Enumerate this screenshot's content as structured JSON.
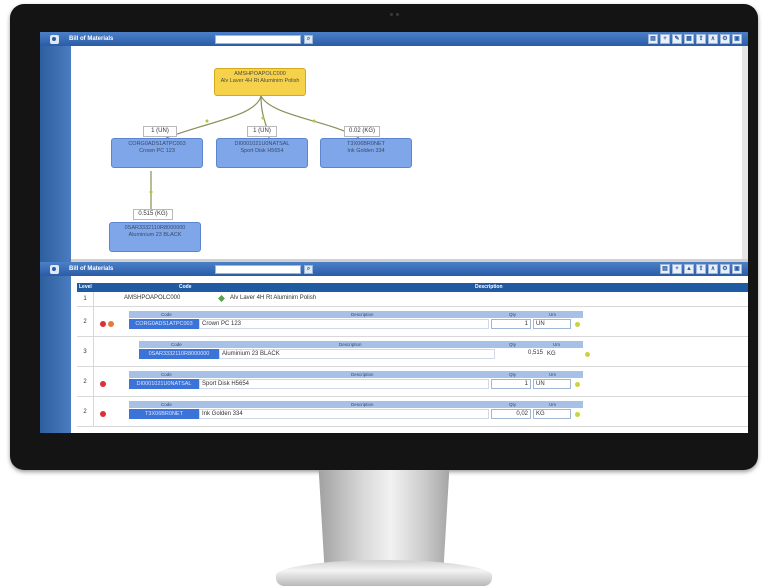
{
  "top_panel": {
    "title": "Bill of Materials",
    "tree": {
      "root": {
        "code": "AMSHPOAPOLC000",
        "desc": "Alv Laver 4H Rt Aluminim Polish"
      },
      "children": [
        {
          "qty": "1 (UN)",
          "code": "CORG0ADS1ATPC003",
          "desc": "Crown PC 123"
        },
        {
          "qty": "1 (UN)",
          "code": "DI0001021U0NATSAL",
          "desc": "Sport Disk H5654"
        },
        {
          "qty": "0.02 (KG)",
          "code": "T3X06BR0NET",
          "desc": "Ink Golden 334"
        }
      ],
      "grandchild": {
        "qty": "0.515 (KG)",
        "code": "0SAR3332110R8000000",
        "desc": "Aluminium 23 BLACK"
      }
    }
  },
  "bottom_panel": {
    "title": "Bill of Materials",
    "headers": {
      "level": "Level",
      "code": "Code",
      "description": "Description"
    },
    "sub_headers": {
      "code": "Code",
      "description": "Description",
      "qty": "Qty",
      "um": "Um"
    },
    "rows": [
      {
        "level": "1",
        "code": "AMSHPOAPOLC000",
        "description": "Alv Laver 4H Rt Aluminim Polish"
      },
      {
        "level": "2",
        "code": "CORG0ADS1ATPC003",
        "description": "Crown PC 123",
        "qty": "1",
        "um": "UN"
      },
      {
        "level": "3",
        "code": "0SAR3332110R8000000",
        "description": "Aluminium 23 BLACK",
        "qty": "0,515",
        "um": "KG"
      },
      {
        "level": "2",
        "code": "DI0001021U0NATSAL",
        "description": "Sport Disk H5654",
        "qty": "1",
        "um": "UN"
      },
      {
        "level": "2",
        "code": "T3X06BR0NET",
        "description": "Ink Golden 334",
        "qty": "0,02",
        "um": "KG"
      }
    ]
  }
}
